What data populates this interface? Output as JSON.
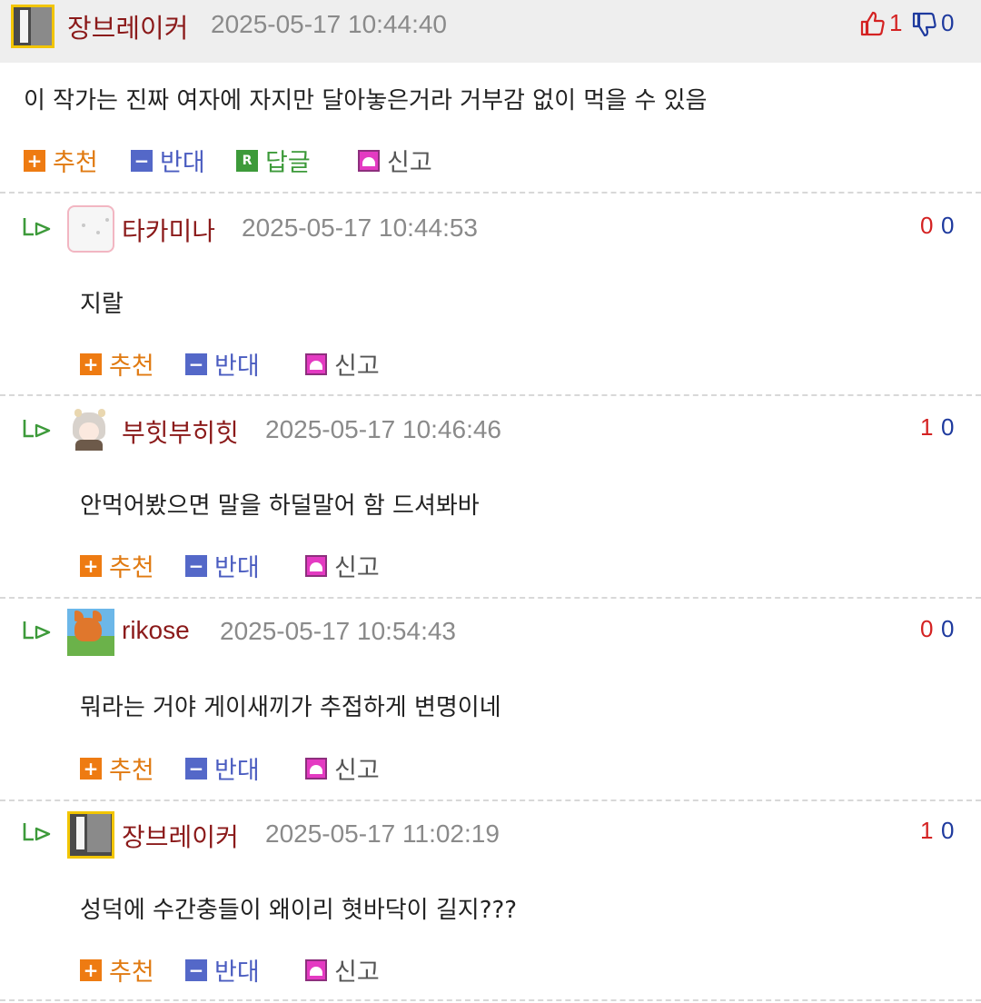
{
  "comments": [
    {
      "nick": "장브레이커",
      "date": "2025-05-17 10:44:40",
      "content": "이 작가는 진짜 여자에 자지만 달아놓은거라 거부감 없이 먹을 수 있음",
      "up": "1",
      "down": "0",
      "buttons": {
        "recommend": "추천",
        "oppose": "반대",
        "reply": "답글",
        "report": "신고"
      }
    },
    {
      "nick": "타카미나",
      "date": "2025-05-17 10:44:53",
      "content": "지랄",
      "up": "0",
      "down": "0",
      "buttons": {
        "recommend": "추천",
        "oppose": "반대",
        "report": "신고"
      }
    },
    {
      "nick": "부힛부히힛",
      "date": "2025-05-17 10:46:46",
      "content": "안먹어봤으면 말을 하덜말어 함 드셔봐바",
      "up": "1",
      "down": "0",
      "buttons": {
        "recommend": "추천",
        "oppose": "반대",
        "report": "신고"
      }
    },
    {
      "nick": "rikose",
      "date": "2025-05-17 10:54:43",
      "content": "뭐라는 거야 게이새끼가 추접하게 변명이네",
      "up": "0",
      "down": "0",
      "buttons": {
        "recommend": "추천",
        "oppose": "반대",
        "report": "신고"
      }
    },
    {
      "nick": "장브레이커",
      "date": "2025-05-17 11:02:19",
      "content": "성덕에 수간충들이 왜이리 혓바닥이 길지???",
      "up": "1",
      "down": "0",
      "buttons": {
        "recommend": "추천",
        "oppose": "반대",
        "report": "신고"
      }
    }
  ],
  "icons": {
    "recommend": "plus-box-icon",
    "oppose": "minus-box-icon",
    "reply": "r-box-icon",
    "report": "siren-icon",
    "reply_indicator": "reply-arrow-icon",
    "upvote": "thumbs-up-icon",
    "downvote": "thumbs-down-icon"
  },
  "colors": {
    "nickname": "#8b1a1a",
    "date": "#8a8a8a",
    "upvote": "#d42222",
    "downvote": "#1e3a9e",
    "recommend": "#e07a12",
    "oppose": "#4a5cc0",
    "reply": "#3d9a3a",
    "report_box": "#e43ac2",
    "header_bg": "#eeeeee"
  }
}
